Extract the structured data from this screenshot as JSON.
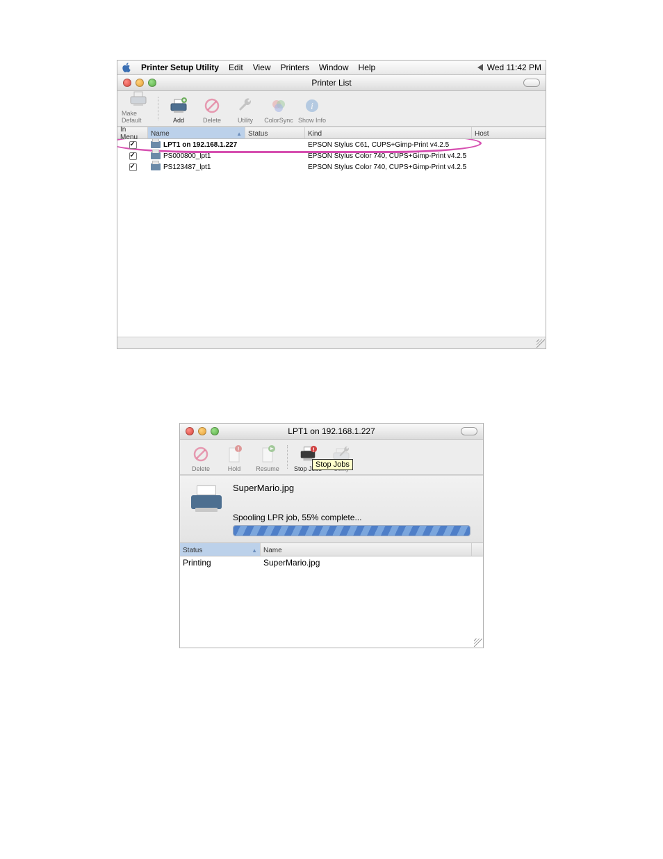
{
  "menubar": {
    "app": "Printer Setup Utility",
    "items": [
      "Edit",
      "View",
      "Printers",
      "Window",
      "Help"
    ],
    "clock": "Wed 11:42 PM"
  },
  "mainWindow": {
    "title": "Printer List",
    "toolbar": [
      {
        "label": "Make Default",
        "enabled": false,
        "icon": "printer-default"
      },
      {
        "label": "Add",
        "enabled": true,
        "icon": "printer-add"
      },
      {
        "label": "Delete",
        "enabled": false,
        "icon": "no-entry"
      },
      {
        "label": "Utility",
        "enabled": false,
        "icon": "wrench"
      },
      {
        "label": "ColorSync",
        "enabled": false,
        "icon": "colorsync"
      },
      {
        "label": "Show Info",
        "enabled": false,
        "icon": "info"
      }
    ],
    "columns": {
      "inmenu": "In Menu",
      "name": "Name",
      "status": "Status",
      "kind": "Kind",
      "host": "Host"
    },
    "rows": [
      {
        "checked": true,
        "name": "LPT1 on 192.168.1.227",
        "kind": "EPSON Stylus C61, CUPS+Gimp-Print v4.2.5",
        "highlighted": true
      },
      {
        "checked": true,
        "name": "PS000800_lpt1",
        "kind": "EPSON Stylus Color 740, CUPS+Gimp-Print v4.2.5",
        "highlighted": false
      },
      {
        "checked": true,
        "name": "PS123487_lpt1",
        "kind": "EPSON Stylus Color 740, CUPS+Gimp-Print v4.2.5",
        "highlighted": false
      }
    ]
  },
  "queueWindow": {
    "title": "LPT1 on 192.168.1.227",
    "toolbar": [
      {
        "label": "Delete",
        "icon": "no-entry",
        "enabled": false
      },
      {
        "label": "Hold",
        "icon": "doc-hold",
        "enabled": false
      },
      {
        "label": "Resume",
        "icon": "doc-resume",
        "enabled": false
      },
      {
        "label": "Stop Jobs",
        "icon": "printer-stop",
        "enabled": true
      },
      {
        "label": "Utility",
        "icon": "wrench",
        "enabled": false
      }
    ],
    "tooltip": "Stop Jobs",
    "job": {
      "file": "SuperMario.jpg",
      "status_line": "Spooling LPR job, 55% complete...",
      "progress_pct": 100
    },
    "columns": {
      "status": "Status",
      "name": "Name"
    },
    "rows": [
      {
        "status": "Printing",
        "name": "SuperMario.jpg"
      }
    ]
  }
}
